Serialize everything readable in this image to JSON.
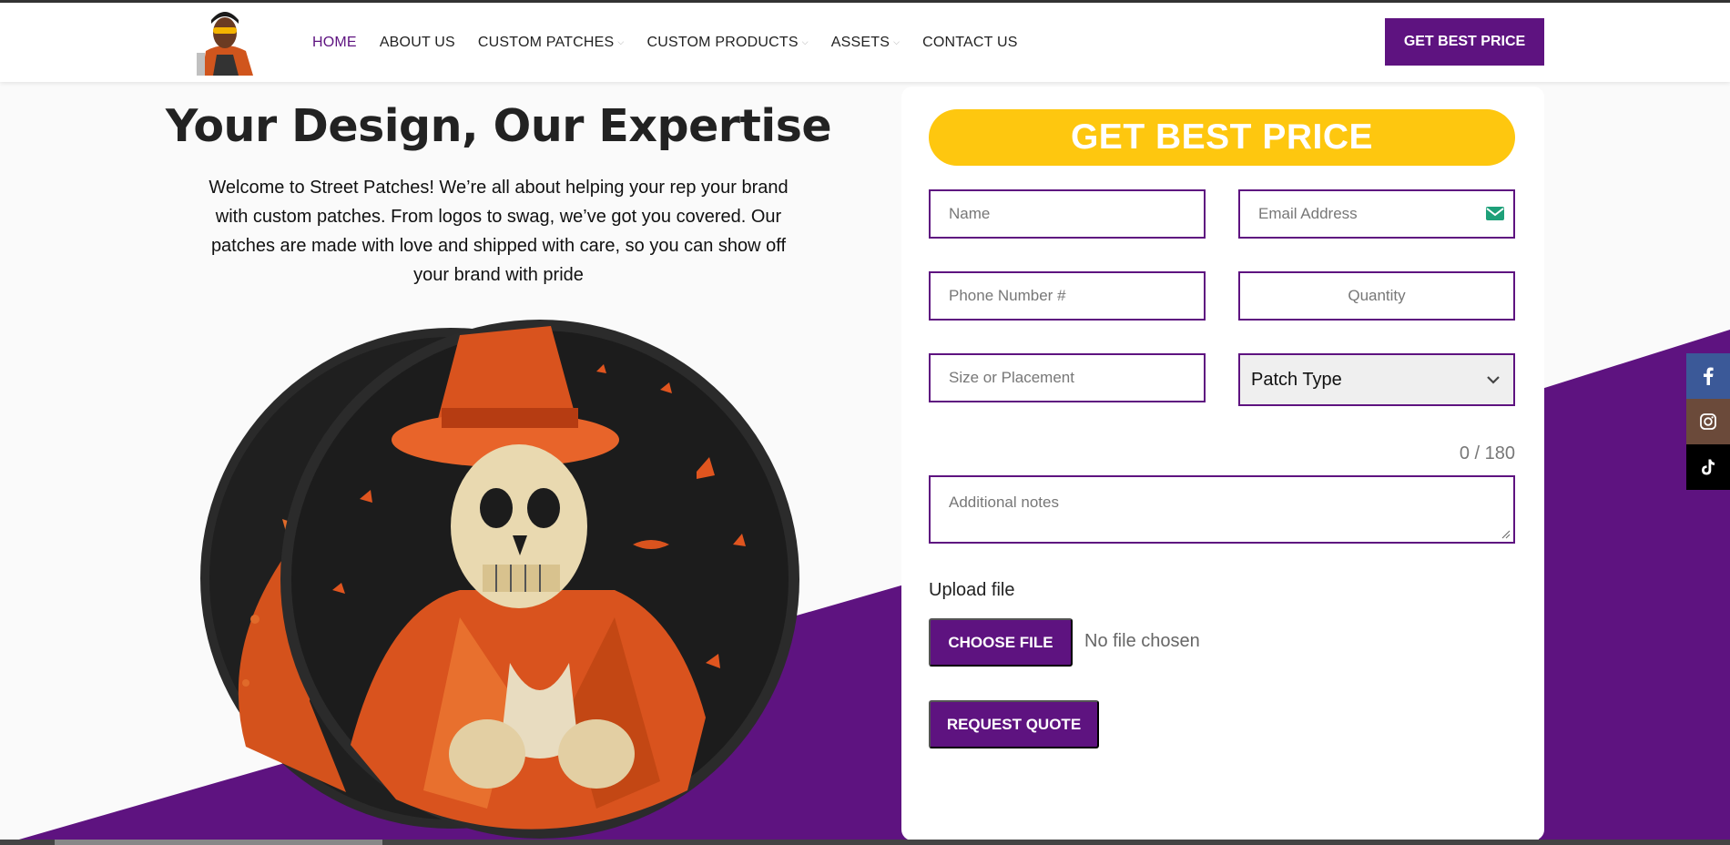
{
  "colors": {
    "brand_purple": "#5e1380",
    "accent_yellow": "#fec70f",
    "facebook": "#3b5998",
    "instagram": "#6b4a3a",
    "tiktok": "#000000"
  },
  "header": {
    "logo_icon": "avatar-logo",
    "nav": [
      {
        "label": "HOME",
        "active": true
      },
      {
        "label": "ABOUT US"
      },
      {
        "label": "CUSTOM PATCHES",
        "dropdown": true
      },
      {
        "label": "CUSTOM PRODUCTS",
        "dropdown": true
      },
      {
        "label": "ASSETS",
        "dropdown": true
      },
      {
        "label": "CONTACT US"
      }
    ],
    "cta_label": "GET BEST PRICE"
  },
  "hero": {
    "title": "Your Design, Our Expertise",
    "text": "Welcome to Street Patches! We’re all about helping your rep your brand with custom patches. From logos to swag, we’ve got you covered. Our patches are made with love and shipped with care, so you can show off your brand with pride"
  },
  "form": {
    "title": "GET BEST PRICE",
    "name_placeholder": "Name",
    "email_placeholder": "Email Address",
    "phone_placeholder": "Phone Number #",
    "quantity_placeholder": "Quantity",
    "size_placeholder": "Size or Placement",
    "patch_type_selected": "Patch Type",
    "counter": "0 / 180",
    "notes_placeholder": "Additional notes",
    "upload_label": "Upload file",
    "choose_file_label": "CHOOSE FILE",
    "no_file_text": "No file chosen",
    "submit_label": "REQUEST QUOTE"
  },
  "social": [
    "facebook-icon",
    "instagram-icon",
    "tiktok-icon"
  ]
}
